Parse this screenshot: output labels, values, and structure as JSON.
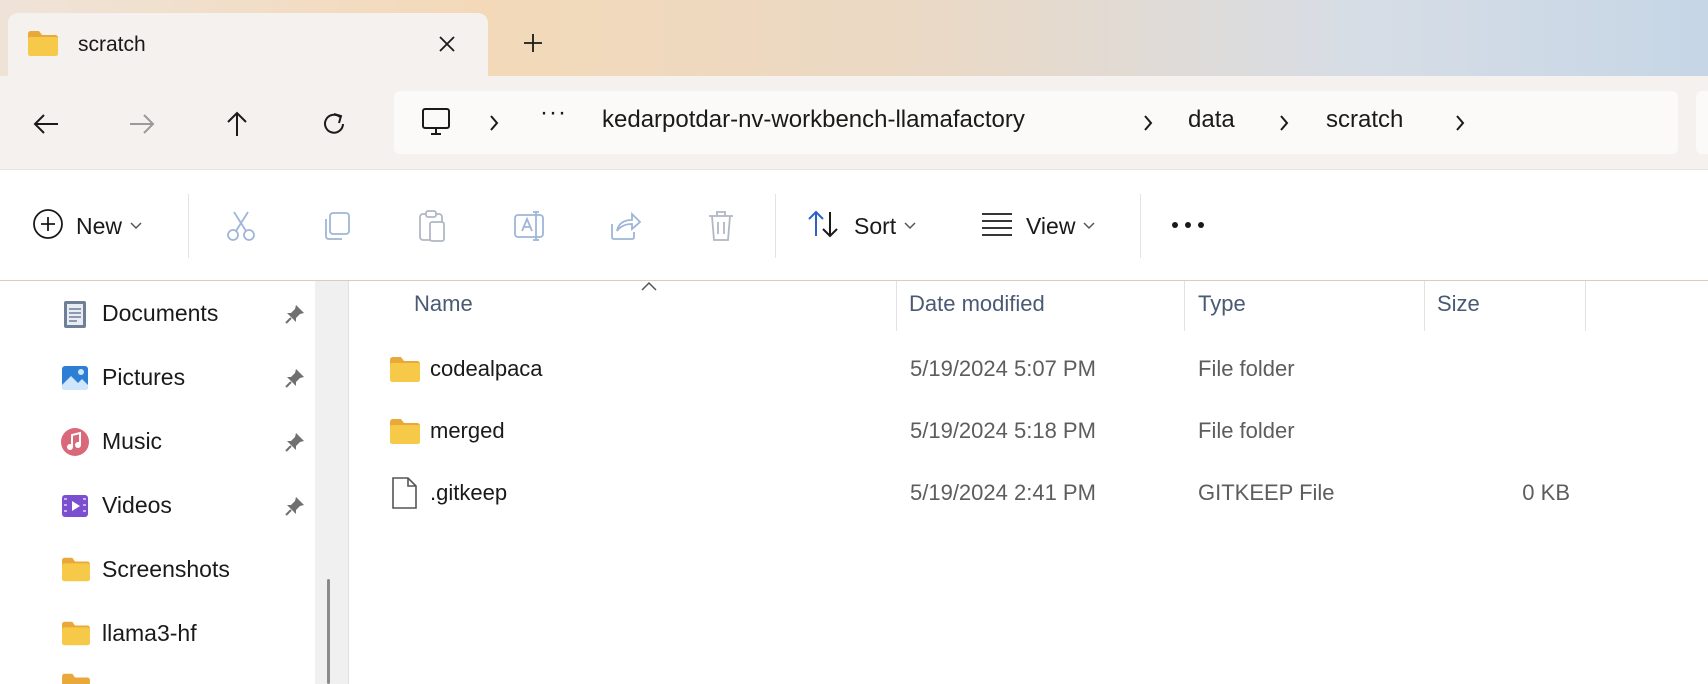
{
  "tab": {
    "title": "scratch",
    "close_icon": "close-icon",
    "new_tab_icon": "plus-icon"
  },
  "nav": {
    "back_icon": "arrow-left-icon",
    "forward_icon": "arrow-right-icon",
    "up_icon": "arrow-up-icon",
    "refresh_icon": "refresh-icon"
  },
  "address": {
    "root_icon": "monitor-icon",
    "overflow": "···",
    "crumbs": [
      "kedarpotdar-nv-workbench-llamafactory",
      "data",
      "scratch"
    ]
  },
  "commands": {
    "new_label": "New",
    "sort_label": "Sort",
    "view_label": "View",
    "more": "···"
  },
  "sidebar": {
    "items": [
      {
        "label": "Documents",
        "icon": "documents-icon",
        "pinned": true
      },
      {
        "label": "Pictures",
        "icon": "pictures-icon",
        "pinned": true
      },
      {
        "label": "Music",
        "icon": "music-icon",
        "pinned": true
      },
      {
        "label": "Videos",
        "icon": "videos-icon",
        "pinned": true
      },
      {
        "label": "Screenshots",
        "icon": "folder-icon",
        "pinned": false
      },
      {
        "label": "llama3-hf",
        "icon": "folder-icon",
        "pinned": false
      }
    ]
  },
  "columns": {
    "name": "Name",
    "date": "Date modified",
    "type": "Type",
    "size": "Size"
  },
  "files": [
    {
      "name": "codealpaca",
      "date": "5/19/2024 5:07 PM",
      "type": "File folder",
      "size": "",
      "icon": "folder-icon"
    },
    {
      "name": "merged",
      "date": "5/19/2024 5:18 PM",
      "type": "File folder",
      "size": "",
      "icon": "folder-icon"
    },
    {
      "name": ".gitkeep",
      "date": "5/19/2024 2:41 PM",
      "type": "GITKEEP File",
      "size": "0 KB",
      "icon": "file-icon"
    }
  ],
  "colors": {
    "folder": "#f6c344",
    "header_text": "#4a5a74",
    "accent": "#2a62c9"
  }
}
